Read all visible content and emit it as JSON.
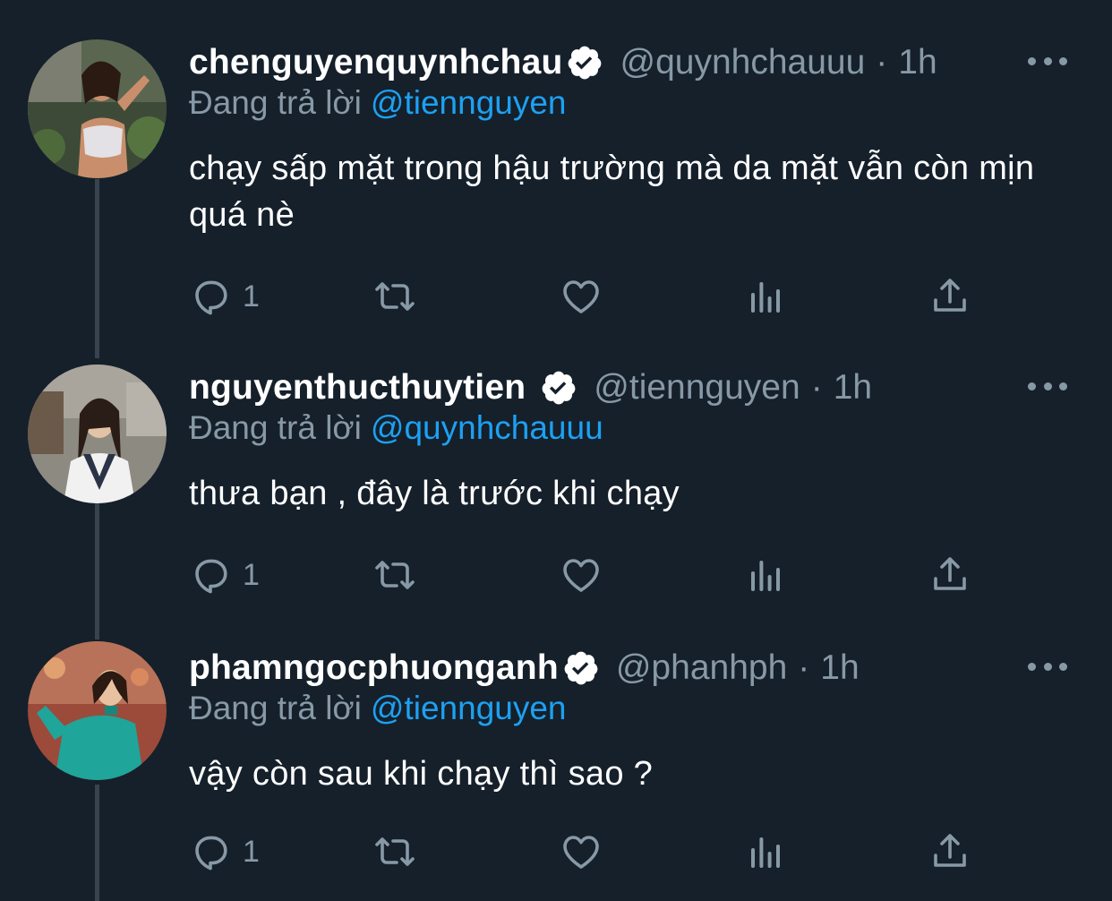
{
  "colors": {
    "background": "#15202b",
    "secondary_text": "#8899a6",
    "link": "#1da1f2",
    "thread_line": "#38444d"
  },
  "tweets": [
    {
      "display_name": "chenguyenquynhchau",
      "verified_icon": "verified-badge-icon",
      "handle": "@quynhchauuu",
      "dot": "·",
      "time": "1h",
      "reply_prefix": "Đang trả lời",
      "reply_to": "@tiennguyen",
      "text": "chạy sấp mặt trong hậu trường mà da mặt vẫn còn mịn quá nè",
      "reply_count": "1"
    },
    {
      "display_name": "nguyenthucthuytien",
      "verified_icon": "verified-badge-icon",
      "handle": "@tiennguyen",
      "dot": "·",
      "time": "1h",
      "reply_prefix": "Đang trả lời",
      "reply_to": "@quynhchauuu",
      "text": "thưa bạn , đây là trước khi chạy",
      "reply_count": "1"
    },
    {
      "display_name": "phamngocphuonganh",
      "verified_icon": "verified-badge-icon",
      "handle": "@phanhph",
      "dot": "·",
      "time": "1h",
      "reply_prefix": "Đang trả lời",
      "reply_to": "@tiennguyen",
      "text": "vậy còn sau khi chạy thì sao ?",
      "reply_count": "1"
    }
  ]
}
